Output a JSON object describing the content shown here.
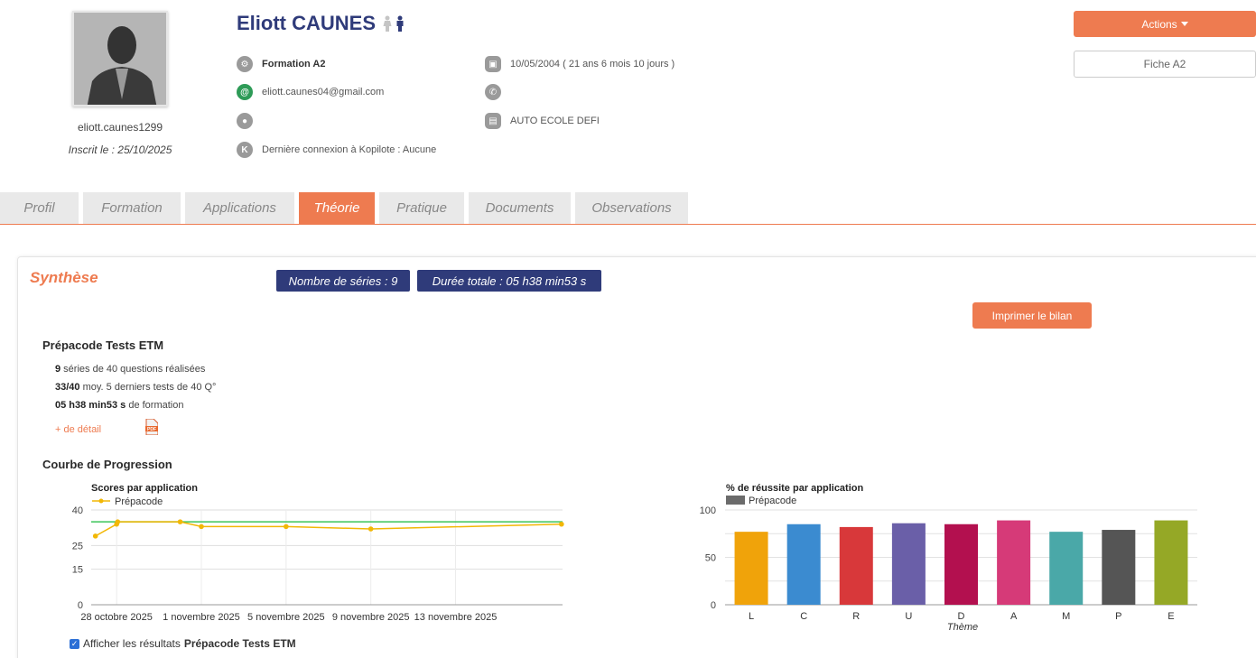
{
  "student": {
    "name": "Eliott CAUNES",
    "username": "eliott.caunes1299",
    "inscrit": "Inscrit le : 25/10/2025",
    "formation": "Formation A2",
    "email": "eliott.caunes04@gmail.com",
    "birth": "10/05/2004 ( 21 ans 6 mois 10 jours )",
    "phone": "",
    "address": "",
    "school": "AUTO ECOLE DEFI",
    "last_login": "Dernière connexion à Kopilote : Aucune",
    "gender_icons": [
      "female-icon",
      "male-icon"
    ]
  },
  "buttons": {
    "actions": "Actions",
    "fiche": "Fiche A2",
    "print": "Imprimer le bilan"
  },
  "tabs": [
    {
      "label": "Profil",
      "active": false
    },
    {
      "label": "Formation",
      "active": false
    },
    {
      "label": "Applications",
      "active": false
    },
    {
      "label": "Théorie",
      "active": true
    },
    {
      "label": "Pratique",
      "active": false
    },
    {
      "label": "Documents",
      "active": false
    },
    {
      "label": "Observations",
      "active": false
    }
  ],
  "synthese": {
    "title": "Synthèse",
    "series_badge": "Nombre de séries : 9",
    "duration_badge": "Durée totale : 05 h38 min53 s"
  },
  "prepacode": {
    "title": "Prépacode Tests ETM",
    "stat1_bold": "9",
    "stat1_text": " séries de 40 questions réalisées",
    "stat2_bold": "33/40",
    "stat2_text": " moy. 5 derniers tests de 40 Q°",
    "stat3_bold": "05 h38 min53 s",
    "stat3_text": " de formation",
    "detail_link": "+ de détail"
  },
  "progression": {
    "title": "Courbe de Progression",
    "checkbox_prefix": "Afficher les résultats ",
    "checkbox_bold": "Prépacode Tests ETM",
    "checked": true
  },
  "colors": {
    "accent": "#ee7b50",
    "navy": "#2f3b7a",
    "line": "#f2b705",
    "threshold": "#3cc45a"
  },
  "chart_data": [
    {
      "type": "line",
      "title": "Scores par application",
      "legend": [
        "Prépacode"
      ],
      "legend_position": "top-left",
      "x_ticks": [
        "28 octobre 2025",
        "1 novembre 2025",
        "5 novembre 2025",
        "9 novembre 2025",
        "13 novembre 2025"
      ],
      "ylim": [
        0,
        40
      ],
      "y_ticks": [
        0,
        15,
        25,
        40
      ],
      "grid": true,
      "series": [
        {
          "name": "Prépacode",
          "x": [
            "2025-10-27",
            "2025-10-28",
            "2025-10-28",
            "2025-10-31",
            "2025-11-01",
            "2025-11-05",
            "2025-11-09",
            "2025-11-18"
          ],
          "y": [
            29,
            34,
            35,
            35,
            33,
            33,
            32,
            34
          ]
        }
      ],
      "threshold": 35
    },
    {
      "type": "bar",
      "title": "% de réussite par application",
      "legend": [
        "Prépacode"
      ],
      "legend_position": "top-left",
      "xlabel": "Thème",
      "categories": [
        "L",
        "C",
        "R",
        "U",
        "D",
        "A",
        "M",
        "P",
        "E"
      ],
      "values": [
        77,
        85,
        82,
        86,
        85,
        89,
        77,
        79,
        89
      ],
      "colors": [
        "#f0a30a",
        "#3b8bd0",
        "#d8383a",
        "#6a5fa8",
        "#b3104f",
        "#d63a78",
        "#4aa8a8",
        "#555555",
        "#95a826"
      ],
      "ylim": [
        0,
        100
      ],
      "y_ticks": [
        0,
        50,
        100
      ],
      "grid": true
    }
  ]
}
